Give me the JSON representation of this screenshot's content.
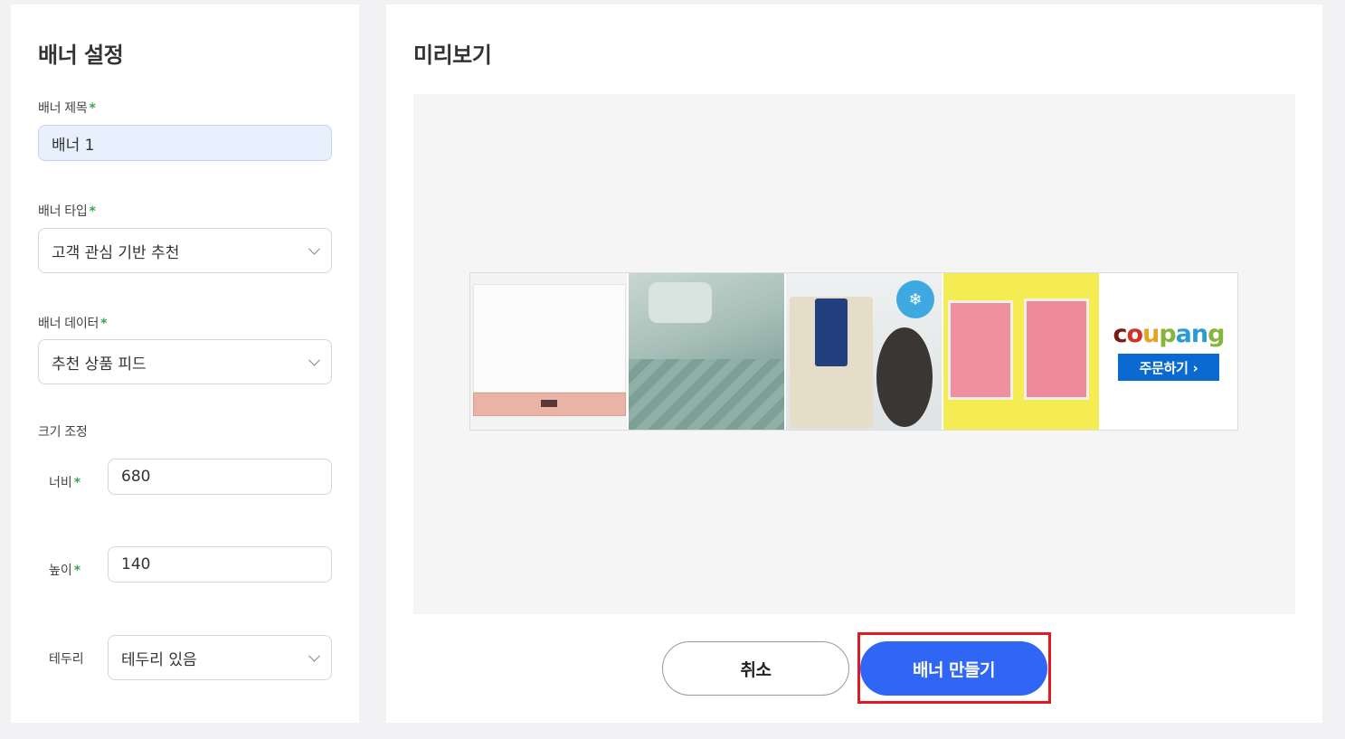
{
  "settings": {
    "title": "배너 설정",
    "banner_title_label": "배너 제목",
    "banner_title_value": "배너 1",
    "banner_type_label": "배너 타입",
    "banner_type_value": "고객 관심 기반 추천",
    "banner_data_label": "배너 데이터",
    "banner_data_value": "추천 상품 피드",
    "size_label": "크기 조정",
    "width_label": "너비",
    "width_value": "680",
    "height_label": "높이",
    "height_value": "140",
    "border_label": "테두리",
    "border_value": "테두리 있음",
    "required_mark": "*"
  },
  "preview": {
    "title": "미리보기",
    "frozen_badge": "❄",
    "coupang_order_label": "주문하기 ›"
  },
  "actions": {
    "cancel_label": "취소",
    "create_label": "배너 만들기"
  },
  "colors": {
    "primary_button": "#2f66f5",
    "highlight": "#e01a22",
    "required": "#3aa54a",
    "coupang_order": "#0b6ad1"
  }
}
